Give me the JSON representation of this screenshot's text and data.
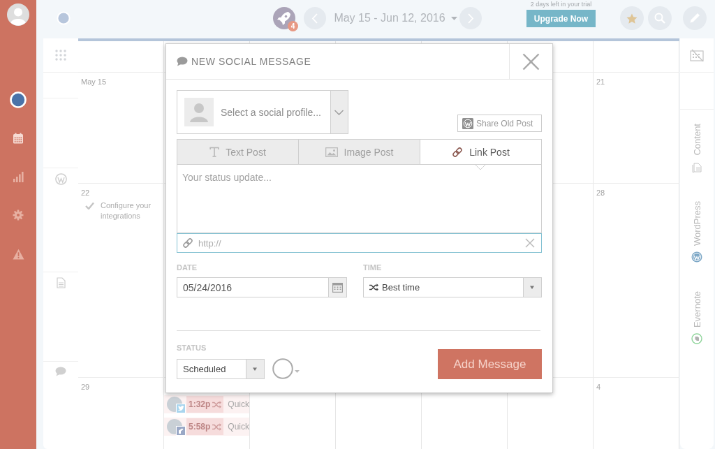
{
  "top_bar": {
    "notification_count": "4",
    "date_range": "May 15 - Jun 12, 2016",
    "trial_notice": "2 days left in your trial",
    "upgrade_button": "Upgrade Now"
  },
  "calendar": {
    "weeks": [
      {
        "day_1": {
          "date": "May 15"
        },
        "day_7": {
          "date": "21"
        }
      },
      {
        "day_1": {
          "date": "22",
          "tasks": [
            {
              "text": "Configure your integrations",
              "done": true
            }
          ]
        },
        "day_7": {
          "date": "28"
        }
      },
      {
        "day_1": {
          "date": "29"
        },
        "day_2": {
          "posts": [
            {
              "time": "1:32p",
              "label": "Quick",
              "kind": "twitter"
            },
            {
              "time": "5:58p",
              "label": "Quick",
              "kind": "facebook"
            }
          ]
        },
        "day_7": {
          "date": "4"
        }
      }
    ]
  },
  "side_panel": {
    "tabs": [
      {
        "label": "Content"
      },
      {
        "label": "WordPress"
      },
      {
        "label": "Evernote"
      }
    ]
  },
  "modal": {
    "title": "NEW SOCIAL MESSAGE",
    "profile_select": {
      "placeholder": "Select a social profile..."
    },
    "share_old_post": "Share Old Post",
    "post_types": [
      {
        "label": "Text Post",
        "selected": false
      },
      {
        "label": "Image Post",
        "selected": false
      },
      {
        "label": "Link Post",
        "selected": true
      }
    ],
    "message": {
      "placeholder": "Your status update..."
    },
    "link": {
      "placeholder": "http://"
    },
    "date": {
      "label": "DATE",
      "value": "05/24/2016"
    },
    "time": {
      "label": "TIME",
      "value": "Best time"
    },
    "status": {
      "label": "STATUS",
      "value": "Scheduled"
    },
    "submit": "Add Message"
  }
}
